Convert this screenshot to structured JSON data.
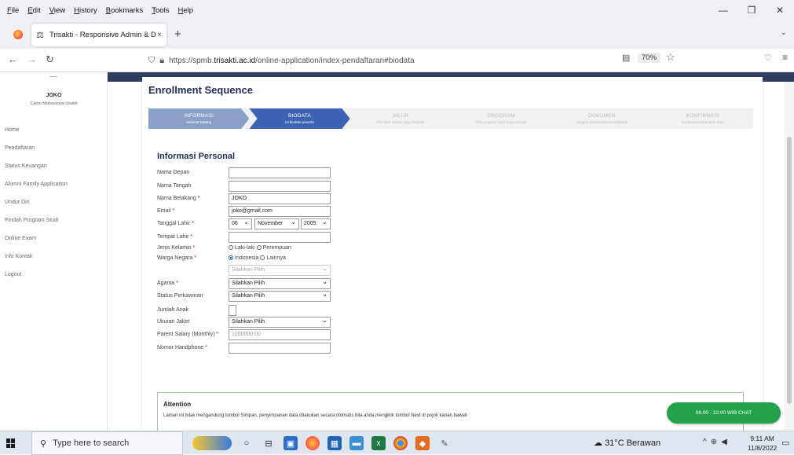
{
  "menubar": {
    "items": [
      "File",
      "Edit",
      "View",
      "History",
      "Bookmarks",
      "Tools",
      "Help"
    ]
  },
  "tab": {
    "title": "Trisakti - Responsive Admin & D",
    "close": "×",
    "new_tab": "+"
  },
  "nav": {
    "url_prefix": "https://spmb.",
    "url_domain": "trisakti.ac.id",
    "url_path": "/online-application/index-pendaftaran#biodata",
    "zoom": "70%"
  },
  "sidebar": {
    "user_name": "JOKO",
    "user_role": "Calon Mahasiswa Usakti",
    "items": [
      "Home",
      "Pendaftaran",
      "Status Keuangan",
      "Alumni Family Application",
      "Undur Diri",
      "Pindah Program Studi",
      "Online Exam",
      "Info Kontak",
      "Logout"
    ]
  },
  "page": {
    "title": "Enrollment Sequence",
    "section_title": "Informasi Personal"
  },
  "steps": [
    {
      "title": "INFORMASI",
      "sub": "Selamat Datang",
      "state": "done"
    },
    {
      "title": "BIODATA",
      "sub": "Isi biodata peserta",
      "state": "active"
    },
    {
      "title": "JALUR",
      "sub": "Pilih jalur seleksi yang diminati",
      "state": "todo"
    },
    {
      "title": "PROGRAM",
      "sub": "Pilih program studi yang diminati",
      "state": "todo"
    },
    {
      "title": "DOKUMEN",
      "sub": "Unggah persyaratan pendaftaran",
      "state": "todo"
    },
    {
      "title": "KONFIRMASI",
      "sub": "Konfirmasi kebenaran data",
      "state": "todo"
    }
  ],
  "form": {
    "nama_depan": {
      "label": "Nama Depan",
      "value": ""
    },
    "nama_tengah": {
      "label": "Nama Tengah",
      "value": ""
    },
    "nama_belakang": {
      "label": "Nama Belakang",
      "value": "JOKO"
    },
    "email": {
      "label": "Email",
      "value": "joko@gmail.com"
    },
    "tanggal_lahir": {
      "label": "Tanggal Lahir",
      "day": "06",
      "month": "November",
      "year": "2005"
    },
    "tempat_lahir": {
      "label": "Tempat Lahir",
      "value": ""
    },
    "jenis_kelamin": {
      "label": "Jenis Kelamin",
      "opt1": "Laki-laki",
      "opt2": "Perempuan"
    },
    "warga_negara": {
      "label": "Warga Negara",
      "opt1": "Indonesia",
      "opt2": "Lainnya",
      "country_select": "Silahkan Pilih"
    },
    "agama": {
      "label": "Agama",
      "value": "Silahkan Pilih"
    },
    "status_perkawinan": {
      "label": "Status Perkawinan",
      "value": "Silahkan Pilih"
    },
    "jumlah_anak": {
      "label": "Jumlah Anak",
      "value": ""
    },
    "ukuran_jaket": {
      "label": "Ukuran Jaket",
      "value": "Silahkan Pilih"
    },
    "parent_salary": {
      "label": "Parent Salary (Monthly)",
      "placeholder": "1000000.00"
    },
    "nomor_hp": {
      "label": "Nomor Handphone",
      "value": ""
    },
    "required_mark": "*"
  },
  "attention": {
    "title": "Attention",
    "text": "Laman ini tidak mengandung tombol Simpan, penyimpanan data dilakukan secara otomatis bila anda mengklik tombol Next di pojok kanan bawah"
  },
  "chat": {
    "label": "06:00 - 22:00 WIB CHAT"
  },
  "taskbar": {
    "search_placeholder": "Type here to search",
    "weather": "31°C Berawan",
    "time": "9:11 AM",
    "date": "11/8/2022"
  }
}
